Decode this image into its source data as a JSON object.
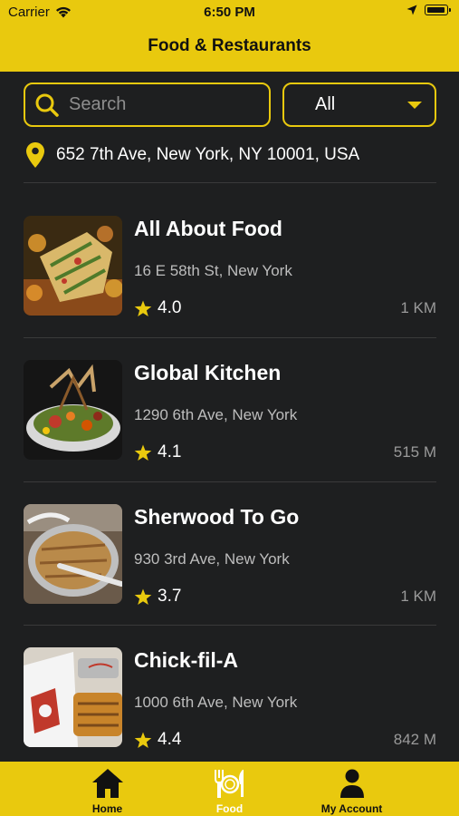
{
  "status": {
    "carrier": "Carrier",
    "time": "6:50 PM"
  },
  "header": {
    "title": "Food & Restaurants"
  },
  "search": {
    "placeholder": "Search"
  },
  "filter": {
    "selected": "All"
  },
  "location": {
    "address": "652 7th Ave, New York, NY 10001, USA"
  },
  "restaurants": [
    {
      "name": "All About Food",
      "address": "16 E 58th St, New York",
      "rating": "4.0",
      "distance": "1 KM"
    },
    {
      "name": "Global Kitchen",
      "address": "1290 6th Ave, New York",
      "rating": "4.1",
      "distance": "515 M"
    },
    {
      "name": "Sherwood To Go",
      "address": "930 3rd Ave, New York",
      "rating": "3.7",
      "distance": "1 KM"
    },
    {
      "name": "Chick-fil-A",
      "address": "1000 6th Ave, New York",
      "rating": "4.4",
      "distance": "842 M"
    }
  ],
  "tabs": [
    {
      "label": "Home",
      "icon": "home-icon",
      "active": false
    },
    {
      "label": "Food",
      "icon": "food-icon",
      "active": true
    },
    {
      "label": "My Account",
      "icon": "account-icon",
      "active": false
    }
  ],
  "colors": {
    "accent": "#e9c90e",
    "background": "#1e1f20"
  }
}
